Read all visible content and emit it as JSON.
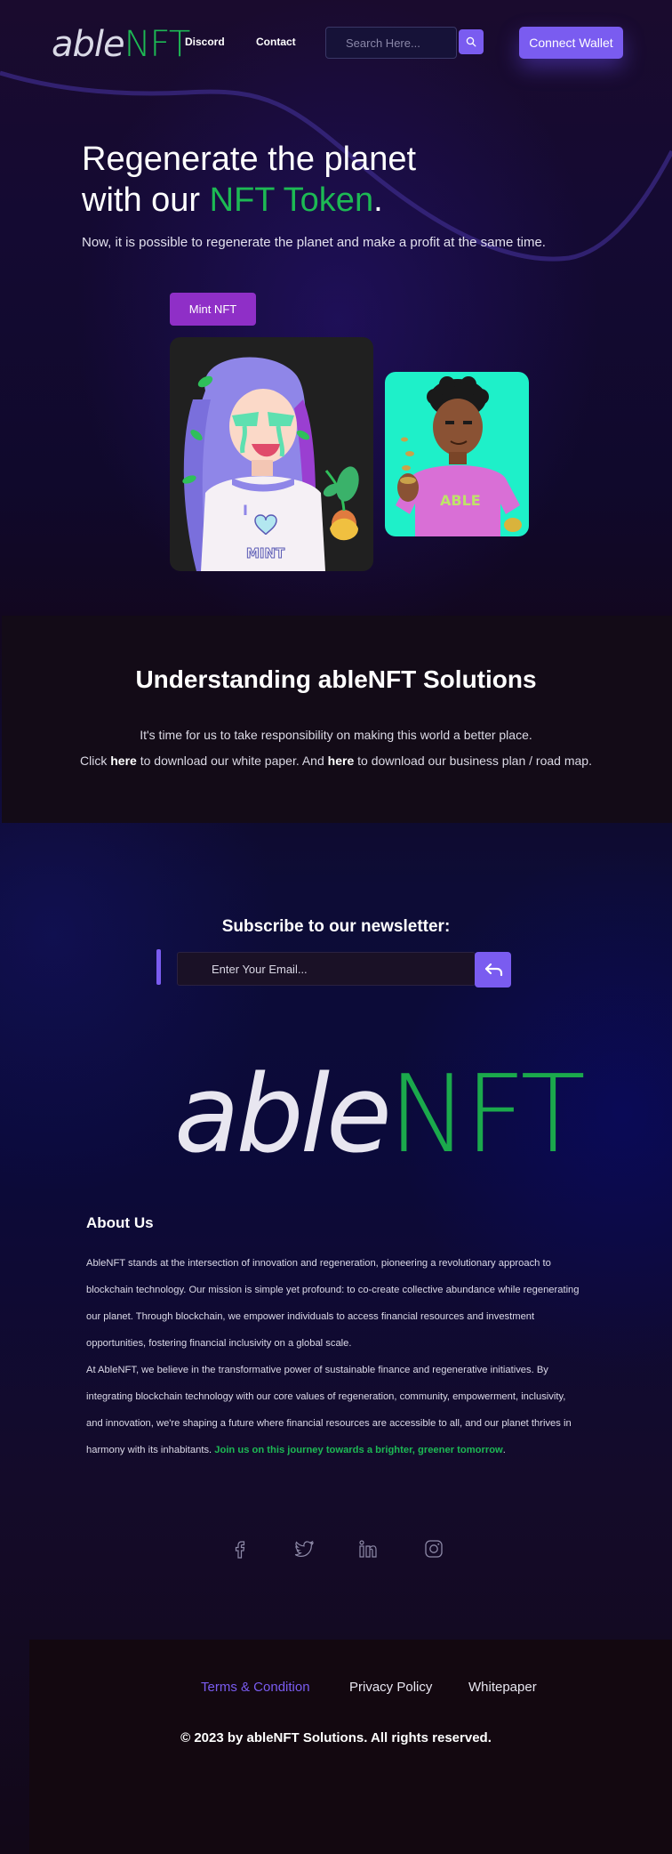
{
  "header": {
    "logo": {
      "part1": "able",
      "part2": "NFT"
    },
    "nav": [
      {
        "label": "Discord"
      },
      {
        "label": "Contact"
      }
    ],
    "search": {
      "placeholder": "Search Here..."
    },
    "connect_label": "Connect Wallet"
  },
  "hero": {
    "title_line1": "Regenerate the planet",
    "title_line2_prefix": "with our ",
    "title_line2_highlight": "NFT Token",
    "title_line2_suffix": ".",
    "subtitle": "Now, it is possible to regenerate the planet and make a profit at the same time.",
    "mint_label": "Mint NFT",
    "card_left_shirt_text": "MINT",
    "card_right_shirt_text": "ABLE"
  },
  "understanding": {
    "title": "Understanding ableNFT Solutions",
    "line1": "It's time for us to take responsibility on making this world a better place.",
    "line2_a": "Click ",
    "link1": "here",
    "line2_b": " to download our white paper. And ",
    "link2": "here",
    "line2_c": " to download our business plan / road map."
  },
  "newsletter": {
    "title": "Subscribe to our newsletter:",
    "placeholder": "Enter Your Email..."
  },
  "about": {
    "title": "About Us",
    "p1": "AbleNFT stands at the intersection of innovation and regeneration, pioneering a revolutionary approach to blockchain technology. Our mission is simple yet profound: to co-create collective abundance while regenerating our planet. Through blockchain, we empower individuals to access financial resources and investment opportunities, fostering financial inclusivity on a global scale.",
    "p2": "At AbleNFT, we believe in the transformative power of sustainable finance and regenerative initiatives. By integrating blockchain technology with our core values of regeneration, community, empowerment, inclusivity, and innovation, we're shaping a future where financial resources are accessible to all, and our planet thrives in harmony with its inhabitants. ",
    "highlight": "Join us on this journey towards a brighter, greener tomorrow",
    "end": "."
  },
  "social": [
    {
      "icon": "facebook-icon"
    },
    {
      "icon": "twitter-icon"
    },
    {
      "icon": "linkedin-icon"
    },
    {
      "icon": "instagram-icon"
    }
  ],
  "footer": {
    "links": [
      {
        "label": "Terms & Condition"
      },
      {
        "label": "Privacy Policy"
      },
      {
        "label": "Whitepaper"
      }
    ],
    "copyright": "© 2023 by ableNFT Solutions. All rights reserved."
  },
  "colors": {
    "accent": "#7a5cf0",
    "brand_green": "#1db954",
    "mint_button": "#8f2fc7",
    "card_right_bg": "#1ef0c9"
  }
}
